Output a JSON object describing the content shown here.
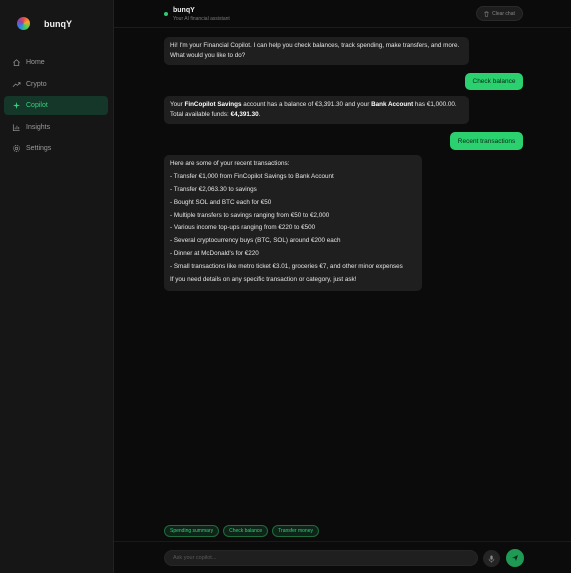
{
  "app": {
    "brand": "bunqY"
  },
  "sidebar": {
    "items": [
      {
        "label": "Home",
        "icon": "home-icon"
      },
      {
        "label": "Crypto",
        "icon": "trend-icon"
      },
      {
        "label": "Copilot",
        "icon": "sparkle-icon",
        "active": true
      },
      {
        "label": "Insights",
        "icon": "bar-chart-icon"
      },
      {
        "label": "Settings",
        "icon": "gear-icon"
      }
    ]
  },
  "header": {
    "name": "bunqY",
    "subtitle": "Your AI financial assistant",
    "clear_label": "Clear chat"
  },
  "chat": {
    "greeting": "Hi! I'm your Financial Copilot. I can help you check balances, track spending, make transfers, and more. What would you like to do?",
    "user_msg_1": "Check balance",
    "balance": {
      "t1": "Your ",
      "savings_name": "FinCopilot Savings",
      "t2": " account has a balance of €3,391.30 and your ",
      "bank_name": "Bank Account",
      "t3": " has €1,000.00. Total available funds: ",
      "total": "€4,391.30",
      "t4": "."
    },
    "user_msg_2": "Recent transactions",
    "transactions": {
      "intro": "Here are some of your recent transactions:",
      "items": [
        "- Transfer €1,000 from FinCopilot Savings to Bank Account",
        "- Transfer €2,063.30 to savings",
        "- Bought SOL and BTC each for €50",
        "- Multiple transfers to savings ranging from €50 to €2,000",
        "- Various income top-ups ranging from €220 to €500",
        "- Several cryptocurrency buys (BTC, SOL) around €200 each",
        "- Dinner at McDonald's for €220",
        "- Small transactions like metro ticket €3.01, groceries €7, and other minor expenses"
      ],
      "outro": "If you need details on any specific transaction or category, just ask!"
    }
  },
  "suggestions": [
    "Spending summary",
    "Check balance",
    "Transfer money"
  ],
  "composer": {
    "placeholder": "Ask your copilot..."
  },
  "colors": {
    "accent": "#2bd06f",
    "active_bg": "#15372a",
    "bubble": "#1f1f1f"
  }
}
